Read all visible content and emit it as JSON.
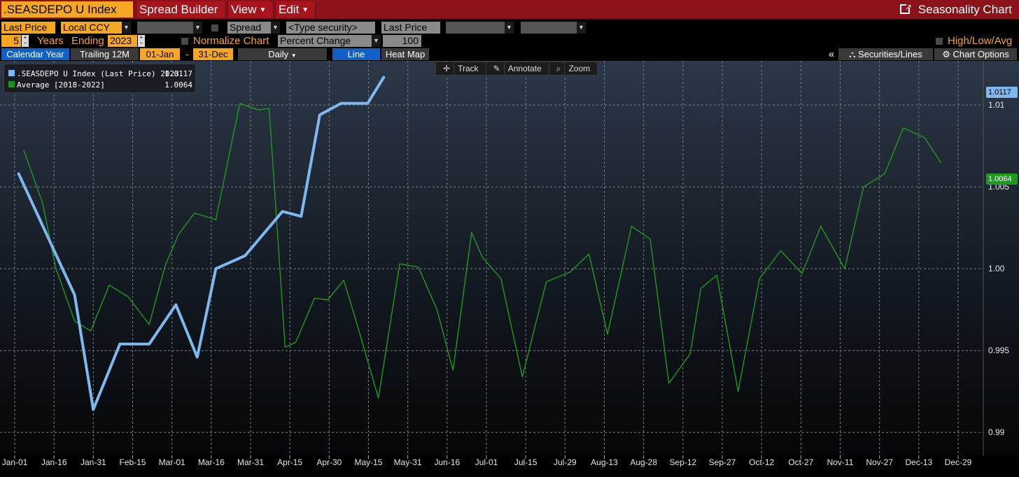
{
  "titlebar": {
    "ticker": ".SEASDEPO U Index",
    "menus": [
      "Spread Builder",
      "View",
      "Edit"
    ],
    "app_title": "Seasonality Chart"
  },
  "controls_row1": {
    "price_field": "Last Price",
    "currency": "Local CCY",
    "spread_label": "Spread",
    "security_placeholder": "<Type security>",
    "price_field2": "Last Price"
  },
  "controls_row2": {
    "years_value": "5",
    "years_label": "Years",
    "ending_label": "Ending",
    "ending_year": "2023",
    "normalize_label": "Normalize Chart",
    "normalize_mode": "Percent Change",
    "normalize_base": "100",
    "hla_label": "High/Low/Avg"
  },
  "controls_row3": {
    "calendar_year": "Calendar Year",
    "trailing": "Trailing 12M",
    "start_date": "01-Jan",
    "dash": "-",
    "end_date": "31-Dec",
    "frequency": "Daily",
    "view_line": "Line",
    "view_heatmap": "Heat Map",
    "collapse": "«",
    "securities_lines": "Securities/Lines",
    "chart_options": "Chart Options"
  },
  "chart_tools": [
    "Track",
    "Annotate",
    "Zoom"
  ],
  "legend": [
    {
      "label": ".SEASDEPO U Index (Last Price) 2023",
      "value": "1.0117",
      "color": "#7fb8ee"
    },
    {
      "label": "Average  [2018-2022]",
      "value": "1.0064",
      "color": "#1f8f1f"
    }
  ],
  "y_badges": {
    "current": "1.0117",
    "average": "1.0064"
  },
  "colors": {
    "accent_orange": "#f5a623",
    "title_red": "#8b1218",
    "series_2023": "#7fb8ee",
    "series_avg": "#1f9a1f",
    "active_tab": "#1160c8"
  },
  "chart_data": {
    "type": "line",
    "x_ticks": [
      "Jan-01",
      "Jan-16",
      "Jan-31",
      "Feb-15",
      "Mar-01",
      "Mar-16",
      "Mar-31",
      "Apr-15",
      "Apr-30",
      "May-15",
      "May-31",
      "Jun-16",
      "Jul-01",
      "Jul-15",
      "Jul-29",
      "Aug-13",
      "Aug-28",
      "Sep-12",
      "Sep-27",
      "Oct-12",
      "Oct-27",
      "Nov-11",
      "Nov-27",
      "Dec-13",
      "Dec-29"
    ],
    "y_ticks": [
      "0.99",
      "0.995",
      "1.00",
      "1.005",
      "1.01"
    ],
    "ylim": [
      0.9886,
      1.0127
    ],
    "xlim_days": [
      -1,
      368
    ],
    "grid": true,
    "legend_position": "top-left",
    "series": [
      {
        "name": ".SEASDEPO U Index (Last Price) 2023",
        "day": [
          6,
          27,
          34,
          44,
          55,
          65,
          73,
          80,
          91,
          105,
          112,
          119,
          127,
          137,
          143
        ],
        "values": [
          1.0058,
          0.9984,
          0.9914,
          0.9954,
          0.9954,
          0.9978,
          0.9946,
          1.0,
          1.0008,
          1.0035,
          1.0032,
          1.0094,
          1.0101,
          1.0101,
          1.0117
        ]
      },
      {
        "name": "Average [2018-2022]",
        "day": [
          8,
          15,
          20,
          27,
          33,
          40,
          47,
          55,
          61,
          66,
          72,
          80,
          89,
          96,
          100,
          106,
          110,
          117,
          122,
          128,
          133,
          141,
          149,
          156,
          163,
          169,
          176,
          180,
          187,
          195,
          204,
          213,
          220,
          227,
          236,
          243,
          250,
          258,
          262,
          268,
          276,
          284,
          292,
          300,
          307,
          316,
          323,
          331,
          338,
          346,
          352
        ],
        "values": [
          1.0072,
          1.004,
          1.0,
          0.9968,
          0.9962,
          0.999,
          0.9983,
          0.9966,
          1.0002,
          1.0021,
          1.0034,
          1.003,
          1.0101,
          1.0097,
          1.0098,
          0.9952,
          0.9955,
          0.9982,
          0.9981,
          0.9993,
          0.9966,
          0.9921,
          1.0003,
          1.0001,
          0.9975,
          0.9938,
          1.0022,
          1.0007,
          0.9994,
          0.9934,
          0.9992,
          0.9998,
          1.0009,
          0.996,
          1.0026,
          1.0018,
          0.993,
          0.9948,
          0.9988,
          0.9996,
          0.9925,
          0.9994,
          1.0011,
          0.9997,
          1.0026,
          1.0,
          1.005,
          1.0058,
          1.0086,
          1.008,
          1.0065
        ]
      }
    ]
  }
}
